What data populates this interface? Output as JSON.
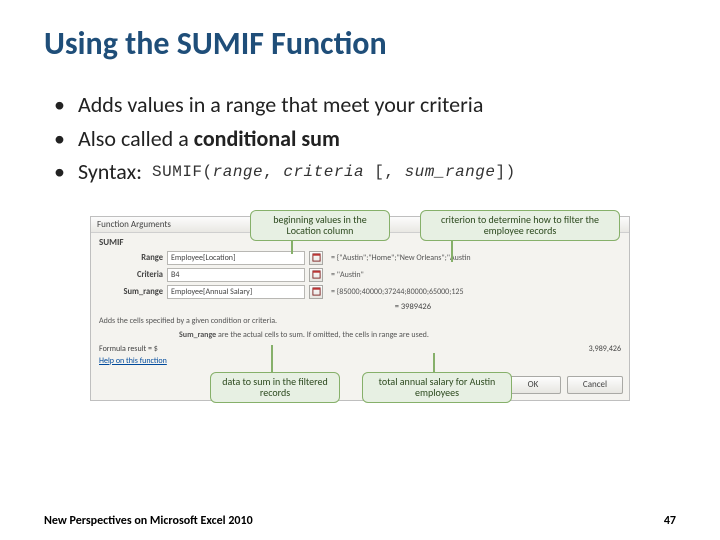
{
  "title": "Using the SUMIF Function",
  "bullets": {
    "b1": "Adds values in a range that meet your criteria",
    "b2_pre": "Also called a ",
    "b2_bold": "conditional sum",
    "b3": "Syntax:"
  },
  "syntax": {
    "fn": "SUMIF(",
    "a1": "range",
    "sep1": ", ",
    "a2": "criteria",
    "opt_open": " [, ",
    "a3": "sum_range",
    "opt_close": "])"
  },
  "callouts": {
    "c1": "beginning values in the Location column",
    "c2": "criterion to determine how to filter the employee records",
    "c3": "data to sum in the filtered records",
    "c4": "total annual salary for Austin employees"
  },
  "dialog": {
    "title": "Function Arguments",
    "fn": "SUMIF",
    "rows": {
      "range": {
        "label": "Range",
        "value": "Employee[Location]",
        "eval": "= {\"Austin\";\"Home\";\"New Orleans\";\"Austin"
      },
      "criteria": {
        "label": "Criteria",
        "value": "B4",
        "eval": "= \"Austin\""
      },
      "sum_range": {
        "label": "Sum_range",
        "value": "Employee[Annual Salary]",
        "eval": "= {85000;40000;37244;80000;65000;125"
      }
    },
    "result_eq": "= 3989426",
    "desc": "Adds the cells specified by a given condition or criteria.",
    "desc2_b": "Sum_range",
    "desc2_rest": " are the actual cells to sum. If omitted, the cells in range are used.",
    "formula_label": "Formula result =    $",
    "formula_value": "3,989,426",
    "help": "Help on this function",
    "ok": "OK",
    "cancel": "Cancel"
  },
  "footer": {
    "left": "New Perspectives on Microsoft Excel 2010",
    "page": "47"
  }
}
